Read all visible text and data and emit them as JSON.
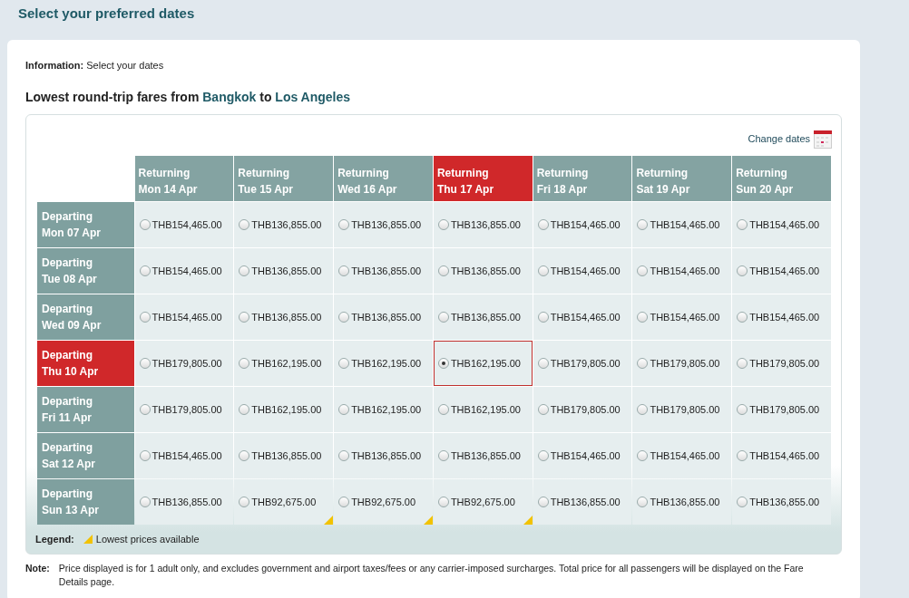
{
  "page_title": "Select your preferred dates",
  "information": {
    "label": "Information:",
    "text": "Select your dates"
  },
  "heading": {
    "prefix": "Lowest round-trip fares from ",
    "origin": "Bangkok",
    "middle": " to ",
    "destination": "Los Angeles"
  },
  "change_dates": "Change dates",
  "columns": [
    {
      "label": "Returning",
      "date": "Mon 14 Apr",
      "selected": false
    },
    {
      "label": "Returning",
      "date": "Tue 15 Apr",
      "selected": false
    },
    {
      "label": "Returning",
      "date": "Wed 16 Apr",
      "selected": false
    },
    {
      "label": "Returning",
      "date": "Thu 17 Apr",
      "selected": true
    },
    {
      "label": "Returning",
      "date": "Fri 18 Apr",
      "selected": false
    },
    {
      "label": "Returning",
      "date": "Sat 19 Apr",
      "selected": false
    },
    {
      "label": "Returning",
      "date": "Sun 20 Apr",
      "selected": false
    }
  ],
  "rows": [
    {
      "label": "Departing",
      "date": "Mon 07 Apr",
      "selected": false,
      "fares": [
        {
          "price": "THB154,465.00",
          "checked": false,
          "lowest": false
        },
        {
          "price": "THB136,855.00",
          "checked": false,
          "lowest": false
        },
        {
          "price": "THB136,855.00",
          "checked": false,
          "lowest": false
        },
        {
          "price": "THB136,855.00",
          "checked": false,
          "lowest": false
        },
        {
          "price": "THB154,465.00",
          "checked": false,
          "lowest": false
        },
        {
          "price": "THB154,465.00",
          "checked": false,
          "lowest": false
        },
        {
          "price": "THB154,465.00",
          "checked": false,
          "lowest": false
        }
      ]
    },
    {
      "label": "Departing",
      "date": "Tue 08 Apr",
      "selected": false,
      "fares": [
        {
          "price": "THB154,465.00",
          "checked": false,
          "lowest": false
        },
        {
          "price": "THB136,855.00",
          "checked": false,
          "lowest": false
        },
        {
          "price": "THB136,855.00",
          "checked": false,
          "lowest": false
        },
        {
          "price": "THB136,855.00",
          "checked": false,
          "lowest": false
        },
        {
          "price": "THB154,465.00",
          "checked": false,
          "lowest": false
        },
        {
          "price": "THB154,465.00",
          "checked": false,
          "lowest": false
        },
        {
          "price": "THB154,465.00",
          "checked": false,
          "lowest": false
        }
      ]
    },
    {
      "label": "Departing",
      "date": "Wed 09 Apr",
      "selected": false,
      "fares": [
        {
          "price": "THB154,465.00",
          "checked": false,
          "lowest": false
        },
        {
          "price": "THB136,855.00",
          "checked": false,
          "lowest": false
        },
        {
          "price": "THB136,855.00",
          "checked": false,
          "lowest": false
        },
        {
          "price": "THB136,855.00",
          "checked": false,
          "lowest": false
        },
        {
          "price": "THB154,465.00",
          "checked": false,
          "lowest": false
        },
        {
          "price": "THB154,465.00",
          "checked": false,
          "lowest": false
        },
        {
          "price": "THB154,465.00",
          "checked": false,
          "lowest": false
        }
      ]
    },
    {
      "label": "Departing",
      "date": "Thu 10 Apr",
      "selected": true,
      "fares": [
        {
          "price": "THB179,805.00",
          "checked": false,
          "lowest": false
        },
        {
          "price": "THB162,195.00",
          "checked": false,
          "lowest": false
        },
        {
          "price": "THB162,195.00",
          "checked": false,
          "lowest": false
        },
        {
          "price": "THB162,195.00",
          "checked": true,
          "lowest": false
        },
        {
          "price": "THB179,805.00",
          "checked": false,
          "lowest": false
        },
        {
          "price": "THB179,805.00",
          "checked": false,
          "lowest": false
        },
        {
          "price": "THB179,805.00",
          "checked": false,
          "lowest": false
        }
      ]
    },
    {
      "label": "Departing",
      "date": "Fri 11 Apr",
      "selected": false,
      "fares": [
        {
          "price": "THB179,805.00",
          "checked": false,
          "lowest": false
        },
        {
          "price": "THB162,195.00",
          "checked": false,
          "lowest": false
        },
        {
          "price": "THB162,195.00",
          "checked": false,
          "lowest": false
        },
        {
          "price": "THB162,195.00",
          "checked": false,
          "lowest": false
        },
        {
          "price": "THB179,805.00",
          "checked": false,
          "lowest": false
        },
        {
          "price": "THB179,805.00",
          "checked": false,
          "lowest": false
        },
        {
          "price": "THB179,805.00",
          "checked": false,
          "lowest": false
        }
      ]
    },
    {
      "label": "Departing",
      "date": "Sat 12 Apr",
      "selected": false,
      "fares": [
        {
          "price": "THB154,465.00",
          "checked": false,
          "lowest": false
        },
        {
          "price": "THB136,855.00",
          "checked": false,
          "lowest": false
        },
        {
          "price": "THB136,855.00",
          "checked": false,
          "lowest": false
        },
        {
          "price": "THB136,855.00",
          "checked": false,
          "lowest": false
        },
        {
          "price": "THB154,465.00",
          "checked": false,
          "lowest": false
        },
        {
          "price": "THB154,465.00",
          "checked": false,
          "lowest": false
        },
        {
          "price": "THB154,465.00",
          "checked": false,
          "lowest": false
        }
      ]
    },
    {
      "label": "Departing",
      "date": "Sun 13 Apr",
      "selected": false,
      "fares": [
        {
          "price": "THB136,855.00",
          "checked": false,
          "lowest": false
        },
        {
          "price": "THB92,675.00",
          "checked": false,
          "lowest": true
        },
        {
          "price": "THB92,675.00",
          "checked": false,
          "lowest": true
        },
        {
          "price": "THB92,675.00",
          "checked": false,
          "lowest": true
        },
        {
          "price": "THB136,855.00",
          "checked": false,
          "lowest": false
        },
        {
          "price": "THB136,855.00",
          "checked": false,
          "lowest": false
        },
        {
          "price": "THB136,855.00",
          "checked": false,
          "lowest": false
        }
      ]
    }
  ],
  "legend": {
    "label": "Legend:",
    "text": "Lowest prices available"
  },
  "note": {
    "label": "Note:",
    "text": "Price displayed is for 1 adult only, and excludes government and airport taxes/fees or any carrier-imposed surcharges. Total price for all passengers will be displayed on the Fare Details page."
  }
}
